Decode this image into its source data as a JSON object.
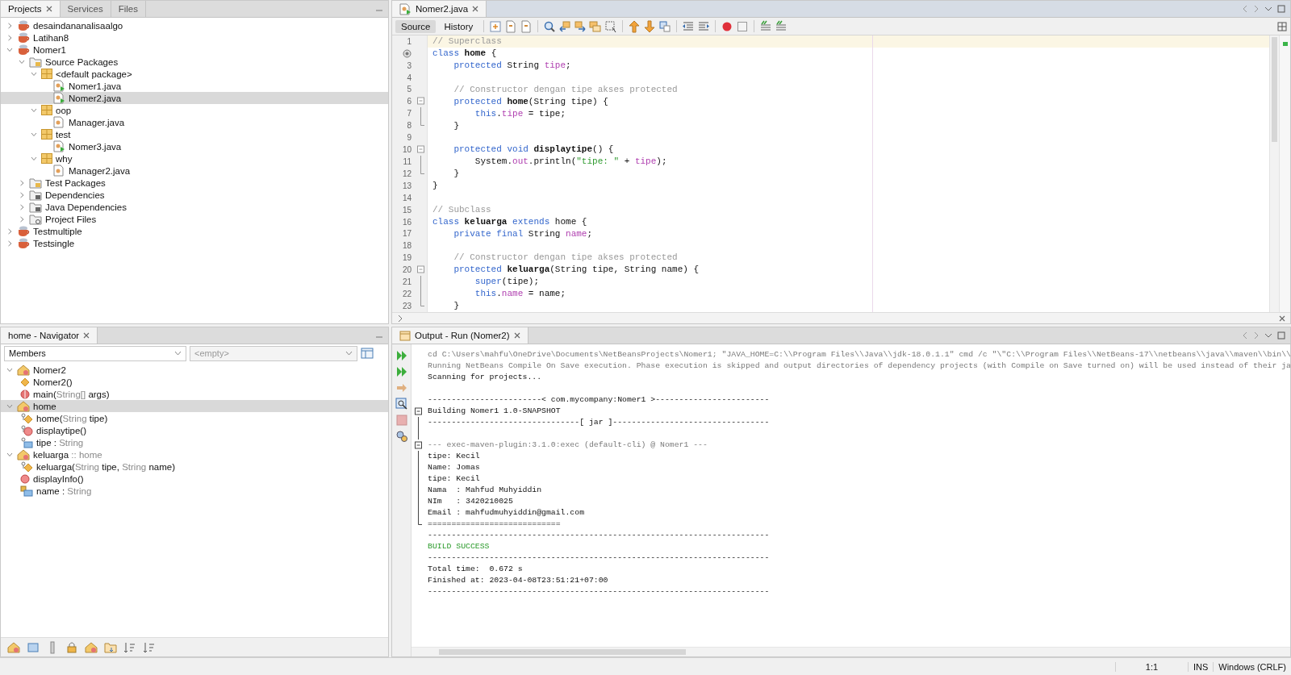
{
  "projects_panel": {
    "tabs": [
      {
        "label": "Projects",
        "selected": true
      },
      {
        "label": "Services",
        "selected": false
      },
      {
        "label": "Files",
        "selected": false
      }
    ],
    "tree": [
      {
        "label": "desaindananalisaalgo",
        "kind": "project",
        "expanded": false,
        "selected": false
      },
      {
        "label": "Latihan8",
        "kind": "project",
        "expanded": false,
        "selected": false
      },
      {
        "label": "Nomer1",
        "kind": "project",
        "expanded": true,
        "selected": false,
        "children": [
          {
            "label": "Source Packages",
            "kind": "source-folder",
            "expanded": true,
            "selected": false,
            "children": [
              {
                "label": "<default package>",
                "kind": "package",
                "expanded": true,
                "selected": false,
                "children": [
                  {
                    "label": "Nomer1.java",
                    "kind": "java-main",
                    "selected": false
                  },
                  {
                    "label": "Nomer2.java",
                    "kind": "java-main",
                    "selected": true
                  }
                ]
              },
              {
                "label": "oop",
                "kind": "package",
                "expanded": true,
                "selected": false,
                "children": [
                  {
                    "label": "Manager.java",
                    "kind": "java",
                    "selected": false
                  }
                ]
              },
              {
                "label": "test",
                "kind": "package",
                "expanded": true,
                "selected": false,
                "children": [
                  {
                    "label": "Nomer3.java",
                    "kind": "java-main",
                    "selected": false
                  }
                ]
              },
              {
                "label": "why",
                "kind": "package",
                "expanded": true,
                "selected": false,
                "children": [
                  {
                    "label": "Manager2.java",
                    "kind": "java",
                    "selected": false
                  }
                ]
              }
            ]
          },
          {
            "label": "Test Packages",
            "kind": "source-folder",
            "expanded": false,
            "selected": false
          },
          {
            "label": "Dependencies",
            "kind": "library-folder",
            "expanded": false,
            "selected": false
          },
          {
            "label": "Java Dependencies",
            "kind": "library-folder",
            "expanded": false,
            "selected": false
          },
          {
            "label": "Project Files",
            "kind": "files-folder",
            "expanded": false,
            "selected": false
          }
        ]
      },
      {
        "label": "Testmultiple",
        "kind": "project",
        "expanded": false,
        "selected": false
      },
      {
        "label": "Testsingle",
        "kind": "project",
        "expanded": false,
        "selected": false
      }
    ]
  },
  "navigator": {
    "tabs": [
      {
        "label": "home - Navigator",
        "selected": true
      }
    ],
    "filter": {
      "value": "Members"
    },
    "scope": {
      "placeholder": "<empty>"
    },
    "members": [
      {
        "kind": "class",
        "parts": [
          {
            "text": "Nomer2",
            "kind": "name"
          }
        ],
        "expanded": true,
        "selected": false,
        "children": [
          {
            "kind": "constructor",
            "parts": [
              {
                "text": "Nomer2()",
                "kind": "name"
              }
            ],
            "selected": false
          },
          {
            "kind": "static-method",
            "parts": [
              {
                "text": "main(",
                "kind": "name"
              },
              {
                "text": "String[]",
                "kind": "type"
              },
              {
                "text": " args)",
                "kind": "name"
              }
            ],
            "selected": false
          }
        ]
      },
      {
        "kind": "class",
        "parts": [
          {
            "text": "home",
            "kind": "name"
          }
        ],
        "expanded": true,
        "selected": true,
        "children": [
          {
            "kind": "protected-constructor",
            "parts": [
              {
                "text": "home(",
                "kind": "name"
              },
              {
                "text": "String",
                "kind": "type"
              },
              {
                "text": " tipe)",
                "kind": "name"
              }
            ],
            "selected": false
          },
          {
            "kind": "protected-method",
            "parts": [
              {
                "text": "displaytipe()",
                "kind": "name"
              }
            ],
            "selected": false
          },
          {
            "kind": "protected-field",
            "parts": [
              {
                "text": "tipe : ",
                "kind": "name"
              },
              {
                "text": "String",
                "kind": "type"
              }
            ],
            "selected": false
          }
        ]
      },
      {
        "kind": "class",
        "parts": [
          {
            "text": "keluarga",
            "kind": "name"
          },
          {
            "text": " :: home",
            "kind": "type"
          }
        ],
        "expanded": true,
        "selected": false,
        "children": [
          {
            "kind": "protected-constructor",
            "parts": [
              {
                "text": "keluarga(",
                "kind": "name"
              },
              {
                "text": "String",
                "kind": "type"
              },
              {
                "text": " tipe, ",
                "kind": "name"
              },
              {
                "text": "String",
                "kind": "type"
              },
              {
                "text": " name)",
                "kind": "name"
              }
            ],
            "selected": false
          },
          {
            "kind": "method",
            "parts": [
              {
                "text": "displayInfo()",
                "kind": "name"
              }
            ],
            "selected": false
          },
          {
            "kind": "private-field",
            "parts": [
              {
                "text": "name : ",
                "kind": "name"
              },
              {
                "text": "String",
                "kind": "type"
              }
            ],
            "selected": false
          }
        ]
      }
    ]
  },
  "editor": {
    "tabs": [
      {
        "label": "Nomer2.java",
        "selected": true
      }
    ],
    "views": [
      {
        "label": "Source",
        "selected": true
      },
      {
        "label": "History",
        "selected": false
      }
    ],
    "lines": [
      {
        "number": "1",
        "kind": "code",
        "current": true,
        "tokens": [
          {
            "kind": "comment",
            "text": "// Superclass"
          }
        ]
      },
      {
        "kind": "annotated",
        "current": false,
        "tokens": [
          {
            "kind": "keyword",
            "text": "class"
          },
          {
            "kind": "bold",
            "text": " home"
          },
          {
            "kind": "plain",
            "text": " {"
          }
        ]
      },
      {
        "number": "3",
        "kind": "code",
        "current": false,
        "tokens": [
          {
            "kind": "keyword",
            "text": "    protected"
          },
          {
            "kind": "plain",
            "text": " String "
          },
          {
            "kind": "field",
            "text": "tipe"
          },
          {
            "kind": "plain",
            "text": ";"
          }
        ]
      },
      {
        "number": "4",
        "kind": "code",
        "current": false
      },
      {
        "number": "5",
        "kind": "code",
        "current": false,
        "tokens": [
          {
            "kind": "comment",
            "text": "    // Constructor dengan tipe akses protected"
          }
        ]
      },
      {
        "number": "6",
        "kind": "code",
        "current": false,
        "expanded": true,
        "tokens": [
          {
            "kind": "keyword",
            "text": "    protected"
          },
          {
            "kind": "bold",
            "text": " home"
          },
          {
            "kind": "plain",
            "text": "(String tipe) {"
          }
        ],
        "children": [
          {
            "number": "7",
            "kind": "code",
            "current": false,
            "tokens": [
              {
                "kind": "keyword",
                "text": "        this"
              },
              {
                "kind": "plain",
                "text": "."
              },
              {
                "kind": "field",
                "text": "tipe"
              },
              {
                "kind": "plain",
                "text": " = tipe;"
              }
            ]
          },
          {
            "number": "8",
            "kind": "code",
            "current": false,
            "tokens": [
              {
                "kind": "plain",
                "text": "    }"
              }
            ]
          }
        ]
      },
      {
        "number": "9",
        "kind": "code",
        "current": false
      },
      {
        "number": "10",
        "kind": "code",
        "current": false,
        "expanded": true,
        "tokens": [
          {
            "kind": "keyword",
            "text": "    protected"
          },
          {
            "kind": "keyword",
            "text": " void"
          },
          {
            "kind": "bold",
            "text": " displaytipe"
          },
          {
            "kind": "plain",
            "text": "() {"
          }
        ],
        "children": [
          {
            "number": "11",
            "kind": "code",
            "current": false,
            "tokens": [
              {
                "kind": "plain",
                "text": "        System."
              },
              {
                "kind": "field",
                "text": "out"
              },
              {
                "kind": "plain",
                "text": ".println("
              },
              {
                "kind": "string",
                "text": "\"tipe: \""
              },
              {
                "kind": "plain",
                "text": " + "
              },
              {
                "kind": "field",
                "text": "tipe"
              },
              {
                "kind": "plain",
                "text": ");"
              }
            ]
          },
          {
            "number": "12",
            "kind": "code",
            "current": false,
            "tokens": [
              {
                "kind": "plain",
                "text": "    }"
              }
            ]
          }
        ]
      },
      {
        "number": "13",
        "kind": "code",
        "current": false,
        "tokens": [
          {
            "kind": "plain",
            "text": "}"
          }
        ]
      },
      {
        "number": "14",
        "kind": "code",
        "current": false
      },
      {
        "number": "15",
        "kind": "code",
        "current": false,
        "tokens": [
          {
            "kind": "comment",
            "text": "// Subclass"
          }
        ]
      },
      {
        "number": "16",
        "kind": "code",
        "current": false,
        "tokens": [
          {
            "kind": "keyword",
            "text": "class"
          },
          {
            "kind": "bold",
            "text": " keluarga"
          },
          {
            "kind": "keyword",
            "text": " extends"
          },
          {
            "kind": "plain",
            "text": " home {"
          }
        ]
      },
      {
        "number": "17",
        "kind": "code",
        "current": false,
        "tokens": [
          {
            "kind": "keyword",
            "text": "    private"
          },
          {
            "kind": "keyword",
            "text": " final"
          },
          {
            "kind": "plain",
            "text": " String "
          },
          {
            "kind": "field",
            "text": "name"
          },
          {
            "kind": "plain",
            "text": ";"
          }
        ]
      },
      {
        "number": "18",
        "kind": "code",
        "current": false
      },
      {
        "number": "19",
        "kind": "code",
        "current": false,
        "tokens": [
          {
            "kind": "comment",
            "text": "    // Constructor dengan tipe akses protected"
          }
        ]
      },
      {
        "number": "20",
        "kind": "code",
        "current": false,
        "expanded": true,
        "tokens": [
          {
            "kind": "keyword",
            "text": "    protected"
          },
          {
            "kind": "bold",
            "text": " keluarga"
          },
          {
            "kind": "plain",
            "text": "(String tipe, String name) {"
          }
        ],
        "children": [
          {
            "number": "21",
            "kind": "code",
            "current": false,
            "tokens": [
              {
                "kind": "keyword",
                "text": "        super"
              },
              {
                "kind": "plain",
                "text": "(tipe);"
              }
            ]
          },
          {
            "number": "22",
            "kind": "code",
            "current": false,
            "tokens": [
              {
                "kind": "keyword",
                "text": "        this"
              },
              {
                "kind": "plain",
                "text": "."
              },
              {
                "kind": "field",
                "text": "name"
              },
              {
                "kind": "plain",
                "text": " = name;"
              }
            ]
          },
          {
            "number": "23",
            "kind": "code",
            "current": false,
            "tokens": [
              {
                "kind": "plain",
                "text": "    }"
              }
            ]
          }
        ]
      }
    ]
  },
  "output": {
    "tabs": [
      {
        "label": "Output - Run (Nomer2)",
        "selected": true
      }
    ],
    "lines": [
      {
        "kind": "command",
        "text": "cd C:\\Users\\mahfu\\OneDrive\\Documents\\NetBeansProjects\\Nomer1; \"JAVA_HOME=C:\\\\Program Files\\\\Java\\\\jdk-18.0.1.1\" cmd /c \"\\\"C:\\\\Program Files\\\\NetBeans-17\\\\netbeans\\\\java\\\\maven\\\\bin\\\\"
      },
      {
        "kind": "command",
        "text": "Running NetBeans Compile On Save execution. Phase execution is skipped and output directories of dependency projects (with Compile on Save turned on) will be used instead of their ja"
      },
      {
        "kind": "plain",
        "text": "Scanning for projects..."
      },
      {
        "kind": "blank"
      },
      {
        "kind": "plain",
        "text": "------------------------< com.mycompany:Nomer1 >------------------------"
      },
      {
        "kind": "plain",
        "text": "Building Nomer1 1.0-SNAPSHOT",
        "expanded": true,
        "children": [
          {
            "kind": "plain",
            "text": "--------------------------------[ jar ]---------------------------------"
          },
          {
            "kind": "blank"
          },
          {
            "kind": "command",
            "text": "--- exec-maven-plugin:3.1.0:exec (default-cli) @ Nomer1 ---",
            "expanded": true,
            "children": [
              {
                "kind": "plain",
                "text": "tipe: Kecil"
              },
              {
                "kind": "plain",
                "text": "Name: Jomas"
              },
              {
                "kind": "plain",
                "text": "tipe: Kecil"
              },
              {
                "kind": "plain",
                "text": "Nama  : Mahfud Muhyiddin"
              },
              {
                "kind": "plain",
                "text": "NIm   : 3420210025"
              },
              {
                "kind": "plain",
                "text": "Email : mahfudmuhyiddin@gmail.com"
              },
              {
                "kind": "plain",
                "text": "============================"
              }
            ]
          }
        ]
      },
      {
        "kind": "plain",
        "text": "------------------------------------------------------------------------"
      },
      {
        "kind": "success",
        "text": "BUILD SUCCESS"
      },
      {
        "kind": "plain",
        "text": "------------------------------------------------------------------------"
      },
      {
        "kind": "plain",
        "text": "Total time:  0.672 s"
      },
      {
        "kind": "plain",
        "text": "Finished at: 2023-04-08T23:51:21+07:00"
      },
      {
        "kind": "plain",
        "text": "------------------------------------------------------------------------"
      }
    ]
  },
  "status_bar": {
    "position": "1:1",
    "mode": "INS",
    "line_endings": "Windows (CRLF)"
  }
}
